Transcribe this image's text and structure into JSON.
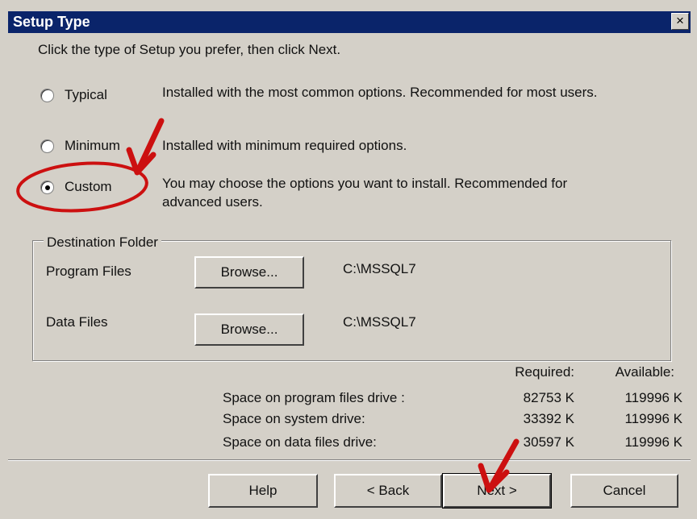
{
  "window": {
    "title": "Setup Type",
    "close_glyph": "×"
  },
  "instruction": "Click the type of Setup you prefer, then click Next.",
  "options": [
    {
      "label": "Typical",
      "description": "Installed with the most common options. Recommended for most users.",
      "selected": false
    },
    {
      "label": "Minimum",
      "description": "Installed with minimum required options.",
      "selected": false
    },
    {
      "label": "Custom",
      "description_line1": "You may choose the options you want to install. Recommended for",
      "description_line2": "advanced users.",
      "selected": true
    }
  ],
  "destination": {
    "legend": "Destination Folder",
    "rows": [
      {
        "label": "Program Files",
        "button": "Browse...",
        "path": "C:\\MSSQL7"
      },
      {
        "label": "Data Files",
        "button": "Browse...",
        "path": "C:\\MSSQL7"
      }
    ]
  },
  "space": {
    "headers": {
      "required": "Required:",
      "available": "Available:"
    },
    "rows": [
      {
        "label": "Space on program files drive :",
        "required": "82753 K",
        "available": "119996 K"
      },
      {
        "label": "Space on system drive:",
        "required": "33392 K",
        "available": "119996 K"
      },
      {
        "label": "Space on data files drive:",
        "required": "30597 K",
        "available": "119996 K"
      }
    ]
  },
  "buttons": {
    "help": "Help",
    "back": "< Back",
    "next": "Next >",
    "cancel": "Cancel"
  },
  "annotation_color": "#cc1010"
}
